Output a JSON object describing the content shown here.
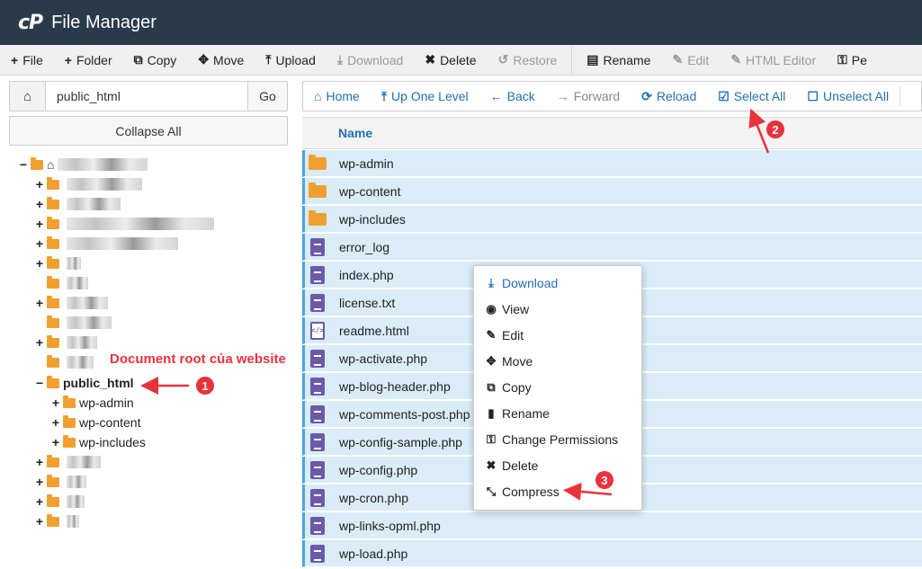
{
  "header": {
    "logo": "cP",
    "title": "File Manager"
  },
  "toolbar": [
    {
      "icon": "+",
      "label": "File",
      "disabled": false
    },
    {
      "icon": "+",
      "label": "Folder",
      "disabled": false
    },
    {
      "icon": "⧉",
      "label": "Copy",
      "disabled": false
    },
    {
      "icon": "✥",
      "label": "Move",
      "disabled": false
    },
    {
      "icon": "⤒",
      "label": "Upload",
      "disabled": false
    },
    {
      "icon": "⤓",
      "label": "Download",
      "disabled": true
    },
    {
      "icon": "✖",
      "label": "Delete",
      "disabled": false
    },
    {
      "icon": "↺",
      "label": "Restore",
      "disabled": true
    },
    {
      "icon": "▤",
      "label": "Rename",
      "disabled": false
    },
    {
      "icon": "✎",
      "label": "Edit",
      "disabled": true
    },
    {
      "icon": "✎",
      "label": "HTML Editor",
      "disabled": true
    },
    {
      "icon": "⚿",
      "label": "Pe",
      "disabled": false
    }
  ],
  "left": {
    "home_icon": "⌂",
    "path_value": "public_html",
    "go_label": "Go",
    "collapse_label": "Collapse All"
  },
  "tree": {
    "root_toggle": "−",
    "public_html": {
      "toggle": "−",
      "label": "public_html"
    },
    "children": [
      "wp-admin",
      "wp-content",
      "wp-includes"
    ],
    "plus": "+"
  },
  "annotations": {
    "doc_root": "Document root của website",
    "badge1": "1",
    "badge2": "2",
    "badge3": "3"
  },
  "nav": [
    {
      "icon": "⌂",
      "label": "Home",
      "disabled": false
    },
    {
      "icon": "⤒",
      "label": "Up One Level",
      "disabled": false
    },
    {
      "icon": "←",
      "label": "Back",
      "disabled": false
    },
    {
      "icon": "→",
      "label": "Forward",
      "disabled": true
    },
    {
      "icon": "⟳",
      "label": "Reload",
      "disabled": false
    },
    {
      "icon": "☑",
      "label": "Select All",
      "disabled": false
    },
    {
      "icon": "☐",
      "label": "Unselect All",
      "disabled": false
    }
  ],
  "table": {
    "header_name": "Name",
    "files": [
      {
        "name": "wp-admin",
        "type": "folder"
      },
      {
        "name": "wp-content",
        "type": "folder"
      },
      {
        "name": "wp-includes",
        "type": "folder"
      },
      {
        "name": "error_log",
        "type": "file"
      },
      {
        "name": "index.php",
        "type": "file"
      },
      {
        "name": "license.txt",
        "type": "file"
      },
      {
        "name": "readme.html",
        "type": "html"
      },
      {
        "name": "wp-activate.php",
        "type": "file"
      },
      {
        "name": "wp-blog-header.php",
        "type": "file"
      },
      {
        "name": "wp-comments-post.php",
        "type": "file"
      },
      {
        "name": "wp-config-sample.php",
        "type": "file"
      },
      {
        "name": "wp-config.php",
        "type": "file"
      },
      {
        "name": "wp-cron.php",
        "type": "file"
      },
      {
        "name": "wp-links-opml.php",
        "type": "file"
      },
      {
        "name": "wp-load.php",
        "type": "file"
      }
    ]
  },
  "context_menu": [
    {
      "icon": "⤓",
      "label": "Download"
    },
    {
      "icon": "◉",
      "label": "View"
    },
    {
      "icon": "✎",
      "label": "Edit"
    },
    {
      "icon": "✥",
      "label": "Move"
    },
    {
      "icon": "⧉",
      "label": "Copy"
    },
    {
      "icon": "▮",
      "label": "Rename"
    },
    {
      "icon": "⚿",
      "label": "Change Permissions"
    },
    {
      "icon": "✖",
      "label": "Delete"
    },
    {
      "icon": "⤡",
      "label": "Compress"
    }
  ],
  "colors": {
    "header_bg": "#293a4a",
    "link_blue": "#1f6fb2",
    "selected_row": "#d9ecf7",
    "annotation_red": "#e8323c",
    "folder": "#f0a030",
    "file_icon": "#6b5aa8"
  }
}
